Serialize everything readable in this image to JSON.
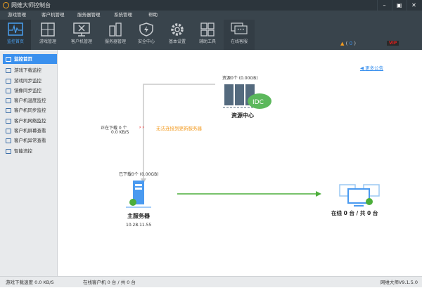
{
  "title": "网维大师控制台",
  "menu": [
    "游戏管理",
    "客户机管理",
    "服务器管理",
    "系统管理",
    "帮助"
  ],
  "toolbar": [
    {
      "label": "监控首页",
      "icon": "monitor-pulse-icon"
    },
    {
      "label": "游戏管理",
      "icon": "gamepad-grid-icon"
    },
    {
      "label": "客户机管理",
      "icon": "client-tools-icon"
    },
    {
      "label": "服务器管理",
      "icon": "server-icon"
    },
    {
      "label": "安全中心",
      "icon": "shield-bolt-icon"
    },
    {
      "label": "基本设置",
      "icon": "gear-icon"
    },
    {
      "label": "辅助工具",
      "icon": "grid-icon"
    },
    {
      "label": "在线客服",
      "icon": "chat-icon"
    }
  ],
  "alert": {
    "open": "(",
    "count": "0",
    "close": ")"
  },
  "vip": "VIP",
  "sidebar": [
    "监控首页",
    "游戏下载监控",
    "游戏同步监控",
    "镜像同步监控",
    "客户机温度监控",
    "客户机同步监控",
    "客户机网络监控",
    "客户机屏幕查看",
    "客户机异常查看",
    "智能流控"
  ],
  "main": {
    "notice": "更多公告",
    "resource_info": "资源0个 (0.00GB)",
    "resource_center": "资源中心",
    "idc": "IDC",
    "downloading": "正在下载 0 个",
    "speed": "0.0 KB/S",
    "error": "无法连接到更新服务器",
    "downloaded": "已下载0个 (0.00GB)",
    "server_name": "主服务器",
    "server_ip": "10.28.11.55",
    "clients": "在线 0 台 / 共 0 台"
  },
  "status": {
    "download_speed": "游戏下载速度 0.0 KB/S",
    "online": "在线客户机 0 台 / 共 0 台",
    "version": "网维大师V9.1.5.0"
  },
  "colors": {
    "accent": "#3a90ee",
    "error": "#f39a1e",
    "link_line": "#4cae3a"
  }
}
